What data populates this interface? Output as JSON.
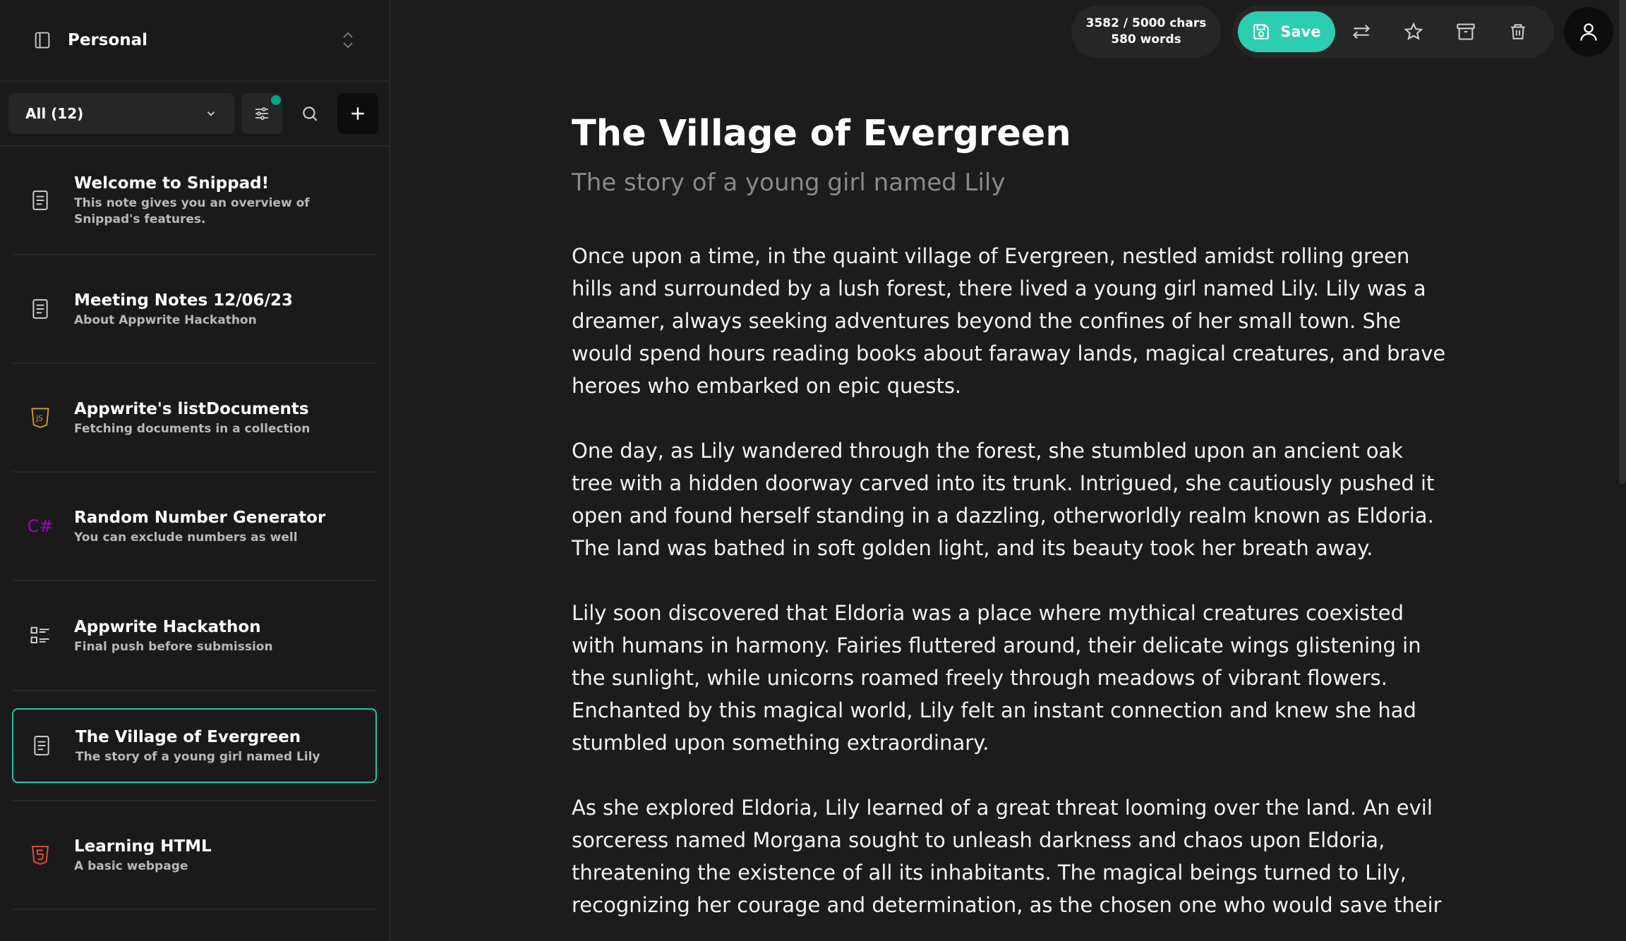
{
  "sidebar": {
    "workspace": "Personal",
    "filter": "All (12)",
    "notes": [
      {
        "title": "Welcome to Snippad!",
        "subtitle": "This note gives you an overview of Snippad's features.",
        "icon": "document-icon"
      },
      {
        "title": "Meeting Notes 12/06/23",
        "subtitle": "About Appwrite Hackathon",
        "icon": "document-icon"
      },
      {
        "title": "Appwrite's listDocuments",
        "subtitle": "Fetching documents in a collection",
        "icon": "javascript-icon"
      },
      {
        "title": "Random Number Generator",
        "subtitle": "You can exclude numbers as well",
        "icon": "csharp-icon"
      },
      {
        "title": "Appwrite Hackathon",
        "subtitle": "Final push before submission",
        "icon": "checklist-icon"
      },
      {
        "title": "The Village of Evergreen",
        "subtitle": "The story of a young girl named Lily",
        "icon": "document-icon"
      },
      {
        "title": "Learning HTML",
        "subtitle": "A basic webpage",
        "icon": "html5-icon"
      }
    ]
  },
  "topbar": {
    "chars": "3582 / 5000 chars",
    "words": "580 words",
    "save_label": "Save"
  },
  "editor": {
    "title": "The Village of Evergreen",
    "subtitle": "The story of a young girl named Lily",
    "paragraphs": [
      "Once upon a time, in the quaint village of Evergreen, nestled amidst rolling green hills and surrounded by a lush forest, there lived a young girl named Lily. Lily was a dreamer, always seeking adventures beyond the confines of her small town. She would spend hours reading books about faraway lands, magical creatures, and brave heroes who embarked on epic quests.",
      "One day, as Lily wandered through the forest, she stumbled upon an ancient oak tree with a hidden doorway carved into its trunk. Intrigued, she cautiously pushed it open and found herself standing in a dazzling, otherworldly realm known as Eldoria. The land was bathed in soft golden light, and its beauty took her breath away.",
      "Lily soon discovered that Eldoria was a place where mythical creatures coexisted with humans in harmony. Fairies fluttered around, their delicate wings glistening in the sunlight, while unicorns roamed freely through meadows of vibrant flowers. Enchanted by this magical world, Lily felt an instant connection and knew she had stumbled upon something extraordinary.",
      "As she explored Eldoria, Lily learned of a great threat looming over the land. An evil sorceress named Morgana sought to unleash darkness and chaos upon Eldoria, threatening the existence of all its inhabitants. The magical beings turned to Lily, recognizing her courage and determination, as the chosen one who would save their"
    ]
  },
  "colors": {
    "accent": "#2dcdb2",
    "active_border": "#1fc7a3",
    "csharp": "#a000c8",
    "javascript": "#c9a227",
    "html": "#e2503a"
  }
}
